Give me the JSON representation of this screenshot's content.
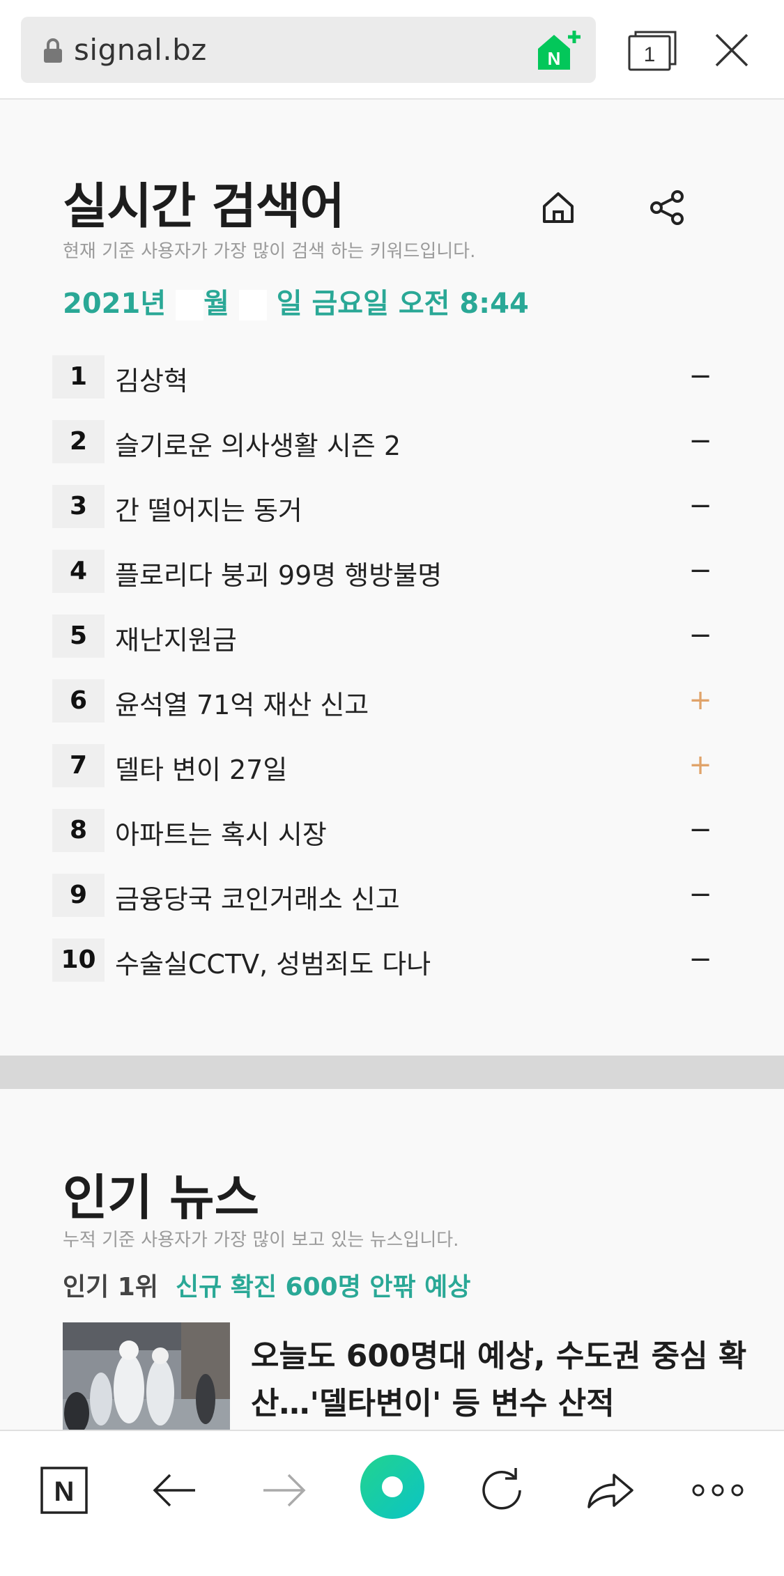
{
  "browser": {
    "url": "signal.bz",
    "tab_count": "1",
    "naver_badge": "N"
  },
  "realtime": {
    "title": "실시간 검색어",
    "subtitle": "현재 기준 사용자가 가장 많이 검색 하는 키워드입니다.",
    "date_year": "2021년",
    "date_month_suffix": "월",
    "date_rest": "일 금요일 오전 8:44",
    "items": [
      {
        "rank": "1",
        "keyword": "김상혁",
        "trend": "−"
      },
      {
        "rank": "2",
        "keyword": "슬기로운 의사생활 시즌 2",
        "trend": "−"
      },
      {
        "rank": "3",
        "keyword": "간 떨어지는 동거",
        "trend": "−"
      },
      {
        "rank": "4",
        "keyword": "플로리다 붕괴 99명 행방불명",
        "trend": "−"
      },
      {
        "rank": "5",
        "keyword": "재난지원금",
        "trend": "−"
      },
      {
        "rank": "6",
        "keyword": "윤석열 71억 재산 신고",
        "trend": "+"
      },
      {
        "rank": "7",
        "keyword": "델타 변이 27일",
        "trend": "+"
      },
      {
        "rank": "8",
        "keyword": "아파트는 혹시 시장",
        "trend": "−"
      },
      {
        "rank": "9",
        "keyword": "금융당국 코인거래소 신고",
        "trend": "−"
      },
      {
        "rank": "10",
        "keyword": "수술실CCTV, 성범죄도 다나",
        "trend": "−"
      }
    ]
  },
  "popular_news": {
    "title": "인기 뉴스",
    "subtitle": "누적 기준 사용자가 가장 많이 보고 있는 뉴스입니다.",
    "rank_label": "인기 1위",
    "rank_headline": "신규 확진 600명 안팎 예상",
    "article_title": "오늘도 600명대 예상, 수도권 중심 확산…'델타변이' 등 변수 산적"
  },
  "toolbar": {
    "naver_home": "N",
    "icons": [
      "naver-home-icon",
      "back-arrow-icon",
      "forward-arrow-icon",
      "green-dot-icon",
      "refresh-icon",
      "share-arrow-icon",
      "more-icon"
    ]
  },
  "colors": {
    "accent": "#2aa896",
    "trend_up": "#e0a36a",
    "naver_green": "#03c75a"
  }
}
